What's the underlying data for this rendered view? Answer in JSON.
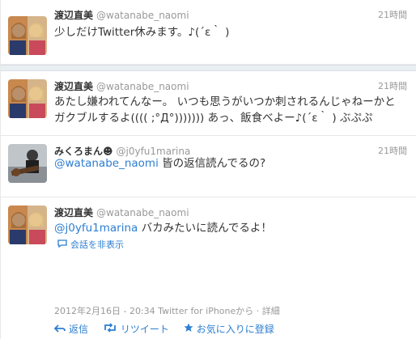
{
  "tweets": [
    {
      "name": "渡辺直美",
      "handle": "@watanabe_naomi",
      "time": "21時間",
      "text": "少しだけTwitter休みます。♪(´ε｀ )"
    },
    {
      "name": "渡辺直美",
      "handle": "@watanabe_naomi",
      "time": "21時間",
      "text": "あたし嫌われてんなー。 いつも思うがいつか刺されるんじゃねーかとガクブルするよ(((( ;°Д°))))))) あっ、飯食べよー♪(´ε｀ ) ぶぷぷ"
    },
    {
      "name": "みくろまん☻",
      "handle": "@j0yfu1marina",
      "time": "21時間",
      "mention": "@watanabe_naomi",
      "text": " 皆の返信読んでるの?"
    },
    {
      "name": "渡辺直美",
      "handle": "@watanabe_naomi",
      "mention": "@j0yfu1marina",
      "text": " バカみたいに読んでるよ！"
    }
  ],
  "hide_conversation": "会話を非表示",
  "meta": "2012年2月16日 - 20:34 Twitter for iPhoneから · 詳細",
  "actions": {
    "reply": "返信",
    "retweet": "リツイート",
    "favorite": "お気に入りに登録"
  },
  "colors": {
    "link": "#2c7ed1",
    "muted": "#999999",
    "separator": "#e9eef2"
  }
}
